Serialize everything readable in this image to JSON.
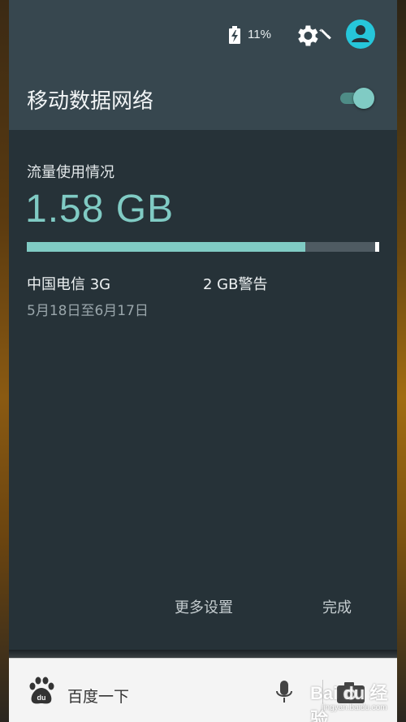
{
  "status": {
    "battery_percent": "11%",
    "icons": [
      "battery-charging-icon",
      "gear-icon",
      "wrench-icon",
      "account-circle-icon"
    ]
  },
  "header": {
    "title": "移动数据网络",
    "toggle_on": true
  },
  "usage": {
    "label": "流量使用情况",
    "value": "1.58 GB",
    "fill_fraction": 0.79
  },
  "details": {
    "carrier": "中国电信 3G",
    "warning": "2 GB警告",
    "period": "5月18日至6月17日"
  },
  "actions": {
    "more_settings": "更多设置",
    "done": "完成"
  },
  "search": {
    "placeholder": "百度一下",
    "icons": [
      "baidu-paw-icon",
      "microphone-icon",
      "camera-icon"
    ]
  },
  "watermark": {
    "text": "Bai du 经验",
    "url": "jingyan.baidu.com"
  },
  "colors": {
    "accent": "#80cbc4",
    "header_bg": "#37474f",
    "panel_bg": "#263238",
    "avatar": "#26c6da"
  }
}
